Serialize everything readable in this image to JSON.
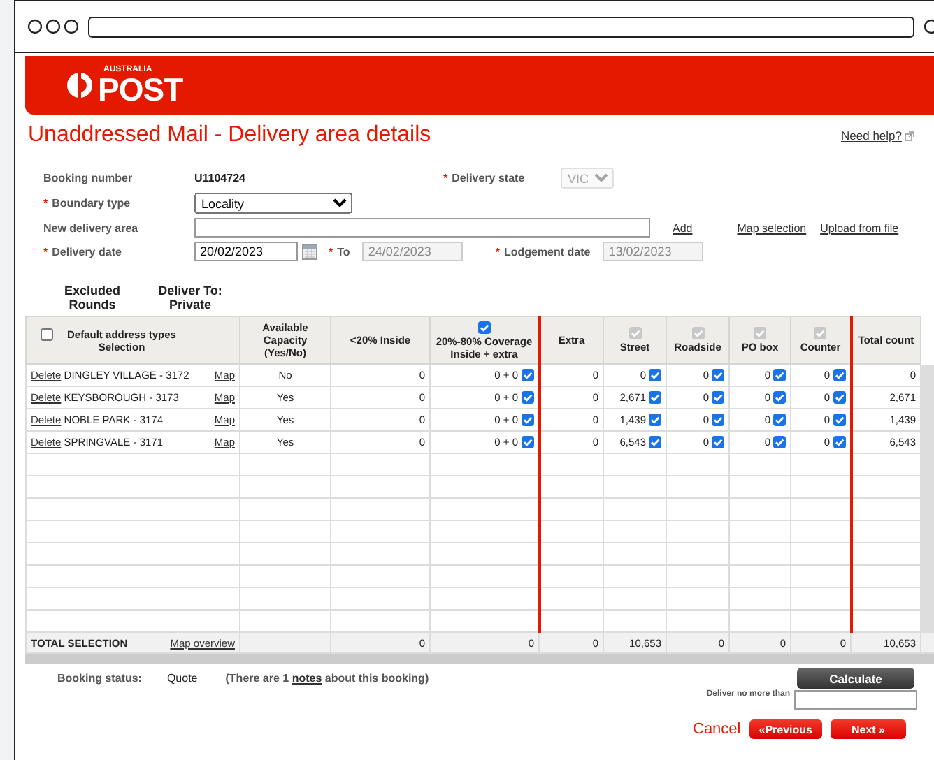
{
  "brand": {
    "small": "AUSTRALIA",
    "big": "POST"
  },
  "page_title": "Unaddressed Mail - Delivery area details",
  "help_link": "Need help?",
  "form": {
    "booking_number_label": "Booking number",
    "booking_number": "U1104724",
    "delivery_state_label": "Delivery state",
    "delivery_state": "VIC",
    "boundary_type_label": "Boundary type",
    "boundary_type": "Locality",
    "new_area_label": "New delivery area",
    "add_link": "Add",
    "map_selection_link": "Map selection",
    "upload_link": "Upload from file",
    "delivery_date_label": "Delivery date",
    "delivery_date": "20/02/2023",
    "to_label": "To",
    "to_date": "24/02/2023",
    "lodgement_label": "Lodgement date",
    "lodgement_date": "13/02/2023",
    "required_mark": "*"
  },
  "section_tabs": [
    {
      "label": "Excluded Rounds"
    },
    {
      "label": "Deliver To: Private"
    }
  ],
  "table": {
    "columns": [
      {
        "label": "Default address types Selection",
        "kind": "checkbox",
        "checked": false,
        "disabled": false
      },
      {
        "label": "Available Capacity (Yes/No)",
        "kind": "text"
      },
      {
        "label": "<20% Inside",
        "kind": "text"
      },
      {
        "label": "20%-80% Coverage Inside + extra",
        "kind": "checkbox",
        "checked": true,
        "disabled": false
      },
      {
        "label": "Extra",
        "kind": "text"
      },
      {
        "label": "Street",
        "kind": "checkbox",
        "checked": true,
        "disabled": true
      },
      {
        "label": "Roadside",
        "kind": "checkbox",
        "checked": true,
        "disabled": true
      },
      {
        "label": "PO box",
        "kind": "checkbox",
        "checked": true,
        "disabled": true
      },
      {
        "label": "Counter",
        "kind": "checkbox",
        "checked": true,
        "disabled": true
      },
      {
        "label": "Total count",
        "kind": "text"
      }
    ],
    "rows": [
      {
        "delete": "Delete",
        "area": "DINGLEY VILLAGE - 3172",
        "map": "Map",
        "capacity": "No",
        "inside": "0",
        "coverage": "0 + 0",
        "coverage_checked": true,
        "extra": "0",
        "street": "0",
        "street_checked": true,
        "roadside": "0",
        "roadside_checked": true,
        "po_box": "0",
        "po_box_checked": true,
        "counter": "0",
        "counter_checked": true,
        "total": "0"
      },
      {
        "delete": "Delete",
        "area": "KEYSBOROUGH - 3173",
        "map": "Map",
        "capacity": "Yes",
        "inside": "0",
        "coverage": "0 + 0",
        "coverage_checked": true,
        "extra": "0",
        "street": "2,671",
        "street_checked": true,
        "roadside": "0",
        "roadside_checked": true,
        "po_box": "0",
        "po_box_checked": true,
        "counter": "0",
        "counter_checked": true,
        "total": "2,671"
      },
      {
        "delete": "Delete",
        "area": "NOBLE PARK - 3174",
        "map": "Map",
        "capacity": "Yes",
        "inside": "0",
        "coverage": "0 + 0",
        "coverage_checked": true,
        "extra": "0",
        "street": "1,439",
        "street_checked": true,
        "roadside": "0",
        "roadside_checked": true,
        "po_box": "0",
        "po_box_checked": true,
        "counter": "0",
        "counter_checked": true,
        "total": "1,439"
      },
      {
        "delete": "Delete",
        "area": "SPRINGVALE - 3171",
        "map": "Map",
        "capacity": "Yes",
        "inside": "0",
        "coverage": "0 + 0",
        "coverage_checked": true,
        "extra": "0",
        "street": "6,543",
        "street_checked": true,
        "roadside": "0",
        "roadside_checked": true,
        "po_box": "0",
        "po_box_checked": true,
        "counter": "0",
        "counter_checked": true,
        "total": "6,543"
      }
    ],
    "total_row": {
      "label": "TOTAL SELECTION",
      "map_overview": "Map overview",
      "inside": "0",
      "coverage": "0",
      "extra": "0",
      "street": "10,653",
      "roadside": "0",
      "po_box": "0",
      "counter": "0",
      "total": "10,653"
    }
  },
  "status": {
    "label": "Booking status:",
    "value": "Quote",
    "notes": "(There are 1 **notes** about this booking)"
  },
  "calculate_button": "Calculate",
  "deliver_limit_label": "Deliver no more than",
  "buttons": {
    "cancel": "Cancel",
    "previous": "«Previous",
    "next": "Next »"
  }
}
